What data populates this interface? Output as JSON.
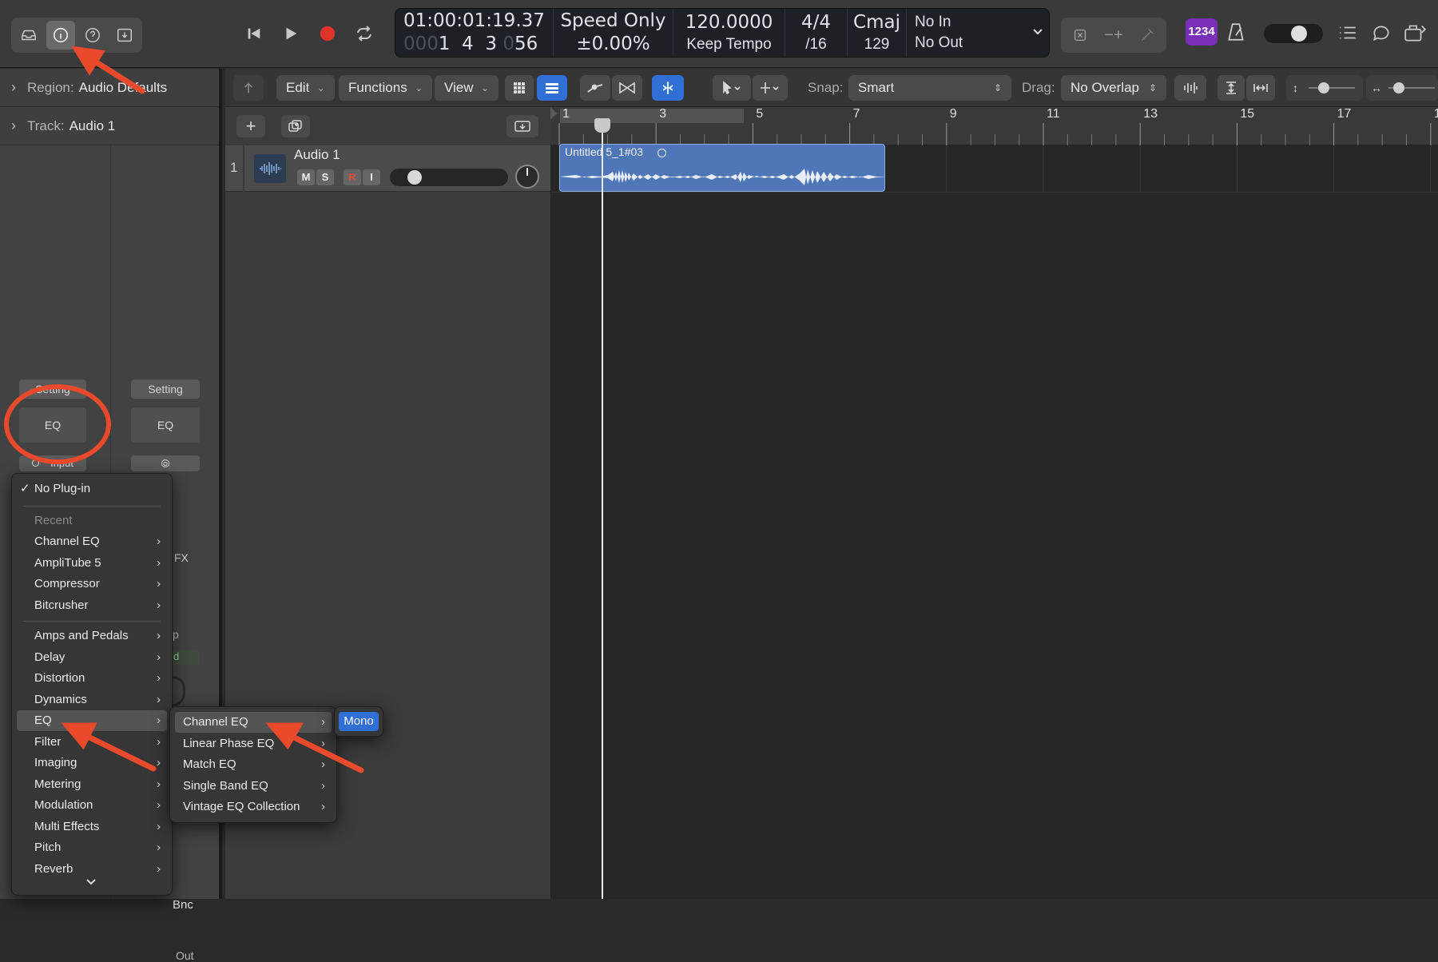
{
  "lcd": {
    "time": "01:00:01:19.37",
    "bars_dim": "000",
    "bars": "1  4  3",
    "ticks_dim": "0",
    "ticks": "56",
    "speed_mode": "Speed Only",
    "speed_value": "±0.00",
    "speed_unit": "%",
    "tempo": "120.0000",
    "tempo_mode": "Keep Tempo",
    "signature": "4/4",
    "division": "/16",
    "key": "Cmaj",
    "key_num": "129",
    "midi_in": "No In",
    "midi_out": "No Out"
  },
  "count_in_badge": "1234",
  "inspector": {
    "region_label": "Region:",
    "region_value": "Audio Defaults",
    "track_label": "Track:",
    "track_value": "Audio 1",
    "setting_left": "Setting",
    "setting_right": "Setting",
    "eq_left": "EQ",
    "eq_right": "EQ",
    "input_partial": "Input",
    "fx_partial": "FX",
    "bnc_partial": "Bnc",
    "out_partial": "Out",
    "p_partial": "p",
    "d_partial": "d"
  },
  "toolbar": {
    "edit": "Edit",
    "functions": "Functions",
    "view": "View",
    "snap_label": "Snap:",
    "snap_value": "Smart",
    "drag_label": "Drag:",
    "drag_value": "No Overlap"
  },
  "track": {
    "number": "1",
    "name": "Audio 1",
    "m": "M",
    "s": "S",
    "r": "R",
    "i": "I"
  },
  "ruler": {
    "bars": [
      "1",
      "3",
      "5",
      "7",
      "9",
      "11",
      "13",
      "15",
      "17",
      "1"
    ]
  },
  "region": {
    "name": "Untitled 5_1#03"
  },
  "plugin_menu": {
    "no_plugin": "No Plug-in",
    "recent_header": "Recent",
    "recent": [
      "Channel EQ",
      "AmpliTube 5",
      "Compressor",
      "Bitcrusher"
    ],
    "categories": [
      "Amps and Pedals",
      "Delay",
      "Distortion",
      "Dynamics",
      "EQ",
      "Filter",
      "Imaging",
      "Metering",
      "Modulation",
      "Multi Effects",
      "Pitch",
      "Reverb"
    ]
  },
  "eq_submenu": [
    "Channel EQ",
    "Linear Phase EQ",
    "Match EQ",
    "Single Band EQ",
    "Vintage EQ Collection"
  ],
  "channel_eq_submenu": [
    "Mono"
  ],
  "colors": {
    "accent": "#2f6fd6",
    "record": "#e0342b",
    "annotation": "#ea4a2c",
    "region": "#4f77b8",
    "badge": "#7a2fb8"
  }
}
